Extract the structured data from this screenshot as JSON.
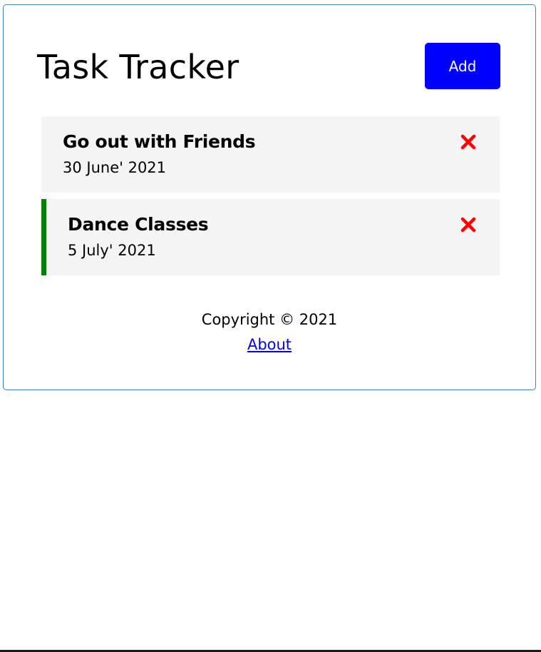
{
  "header": {
    "title": "Task Tracker",
    "add_label": "Add"
  },
  "tasks": [
    {
      "text": "Go out with Friends",
      "day": "30 June' 2021",
      "reminder": false
    },
    {
      "text": "Dance Classes",
      "day": "5 July' 2021",
      "reminder": true
    }
  ],
  "footer": {
    "copyright": "Copyright © 2021",
    "about_label": "About"
  },
  "colors": {
    "add_button": "#0000ff",
    "delete_icon": "#ff0000",
    "reminder_border": "#008000",
    "task_background": "#f4f4f4",
    "container_border": "#4682b4"
  },
  "icons": {
    "delete": "close-icon"
  }
}
